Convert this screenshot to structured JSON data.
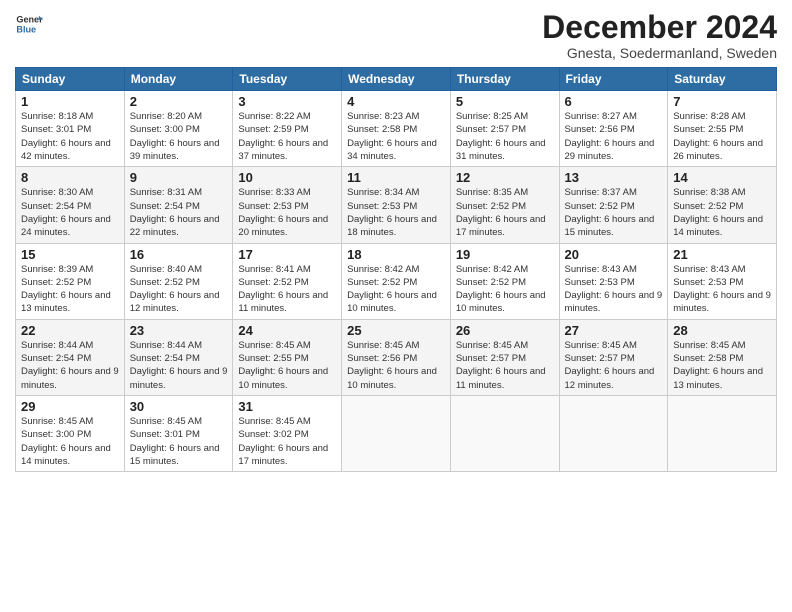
{
  "header": {
    "logo_line1": "General",
    "logo_line2": "Blue",
    "month": "December 2024",
    "location": "Gnesta, Soedermanland, Sweden"
  },
  "weekdays": [
    "Sunday",
    "Monday",
    "Tuesday",
    "Wednesday",
    "Thursday",
    "Friday",
    "Saturday"
  ],
  "weeks": [
    [
      {
        "day": "1",
        "sunrise": "8:18 AM",
        "sunset": "3:01 PM",
        "daylight": "6 hours and 42 minutes."
      },
      {
        "day": "2",
        "sunrise": "8:20 AM",
        "sunset": "3:00 PM",
        "daylight": "6 hours and 39 minutes."
      },
      {
        "day": "3",
        "sunrise": "8:22 AM",
        "sunset": "2:59 PM",
        "daylight": "6 hours and 37 minutes."
      },
      {
        "day": "4",
        "sunrise": "8:23 AM",
        "sunset": "2:58 PM",
        "daylight": "6 hours and 34 minutes."
      },
      {
        "day": "5",
        "sunrise": "8:25 AM",
        "sunset": "2:57 PM",
        "daylight": "6 hours and 31 minutes."
      },
      {
        "day": "6",
        "sunrise": "8:27 AM",
        "sunset": "2:56 PM",
        "daylight": "6 hours and 29 minutes."
      },
      {
        "day": "7",
        "sunrise": "8:28 AM",
        "sunset": "2:55 PM",
        "daylight": "6 hours and 26 minutes."
      }
    ],
    [
      {
        "day": "8",
        "sunrise": "8:30 AM",
        "sunset": "2:54 PM",
        "daylight": "6 hours and 24 minutes."
      },
      {
        "day": "9",
        "sunrise": "8:31 AM",
        "sunset": "2:54 PM",
        "daylight": "6 hours and 22 minutes."
      },
      {
        "day": "10",
        "sunrise": "8:33 AM",
        "sunset": "2:53 PM",
        "daylight": "6 hours and 20 minutes."
      },
      {
        "day": "11",
        "sunrise": "8:34 AM",
        "sunset": "2:53 PM",
        "daylight": "6 hours and 18 minutes."
      },
      {
        "day": "12",
        "sunrise": "8:35 AM",
        "sunset": "2:52 PM",
        "daylight": "6 hours and 17 minutes."
      },
      {
        "day": "13",
        "sunrise": "8:37 AM",
        "sunset": "2:52 PM",
        "daylight": "6 hours and 15 minutes."
      },
      {
        "day": "14",
        "sunrise": "8:38 AM",
        "sunset": "2:52 PM",
        "daylight": "6 hours and 14 minutes."
      }
    ],
    [
      {
        "day": "15",
        "sunrise": "8:39 AM",
        "sunset": "2:52 PM",
        "daylight": "6 hours and 13 minutes."
      },
      {
        "day": "16",
        "sunrise": "8:40 AM",
        "sunset": "2:52 PM",
        "daylight": "6 hours and 12 minutes."
      },
      {
        "day": "17",
        "sunrise": "8:41 AM",
        "sunset": "2:52 PM",
        "daylight": "6 hours and 11 minutes."
      },
      {
        "day": "18",
        "sunrise": "8:42 AM",
        "sunset": "2:52 PM",
        "daylight": "6 hours and 10 minutes."
      },
      {
        "day": "19",
        "sunrise": "8:42 AM",
        "sunset": "2:52 PM",
        "daylight": "6 hours and 10 minutes."
      },
      {
        "day": "20",
        "sunrise": "8:43 AM",
        "sunset": "2:53 PM",
        "daylight": "6 hours and 9 minutes."
      },
      {
        "day": "21",
        "sunrise": "8:43 AM",
        "sunset": "2:53 PM",
        "daylight": "6 hours and 9 minutes."
      }
    ],
    [
      {
        "day": "22",
        "sunrise": "8:44 AM",
        "sunset": "2:54 PM",
        "daylight": "6 hours and 9 minutes."
      },
      {
        "day": "23",
        "sunrise": "8:44 AM",
        "sunset": "2:54 PM",
        "daylight": "6 hours and 9 minutes."
      },
      {
        "day": "24",
        "sunrise": "8:45 AM",
        "sunset": "2:55 PM",
        "daylight": "6 hours and 10 minutes."
      },
      {
        "day": "25",
        "sunrise": "8:45 AM",
        "sunset": "2:56 PM",
        "daylight": "6 hours and 10 minutes."
      },
      {
        "day": "26",
        "sunrise": "8:45 AM",
        "sunset": "2:57 PM",
        "daylight": "6 hours and 11 minutes."
      },
      {
        "day": "27",
        "sunrise": "8:45 AM",
        "sunset": "2:57 PM",
        "daylight": "6 hours and 12 minutes."
      },
      {
        "day": "28",
        "sunrise": "8:45 AM",
        "sunset": "2:58 PM",
        "daylight": "6 hours and 13 minutes."
      }
    ],
    [
      {
        "day": "29",
        "sunrise": "8:45 AM",
        "sunset": "3:00 PM",
        "daylight": "6 hours and 14 minutes."
      },
      {
        "day": "30",
        "sunrise": "8:45 AM",
        "sunset": "3:01 PM",
        "daylight": "6 hours and 15 minutes."
      },
      {
        "day": "31",
        "sunrise": "8:45 AM",
        "sunset": "3:02 PM",
        "daylight": "6 hours and 17 minutes."
      },
      null,
      null,
      null,
      null
    ]
  ]
}
